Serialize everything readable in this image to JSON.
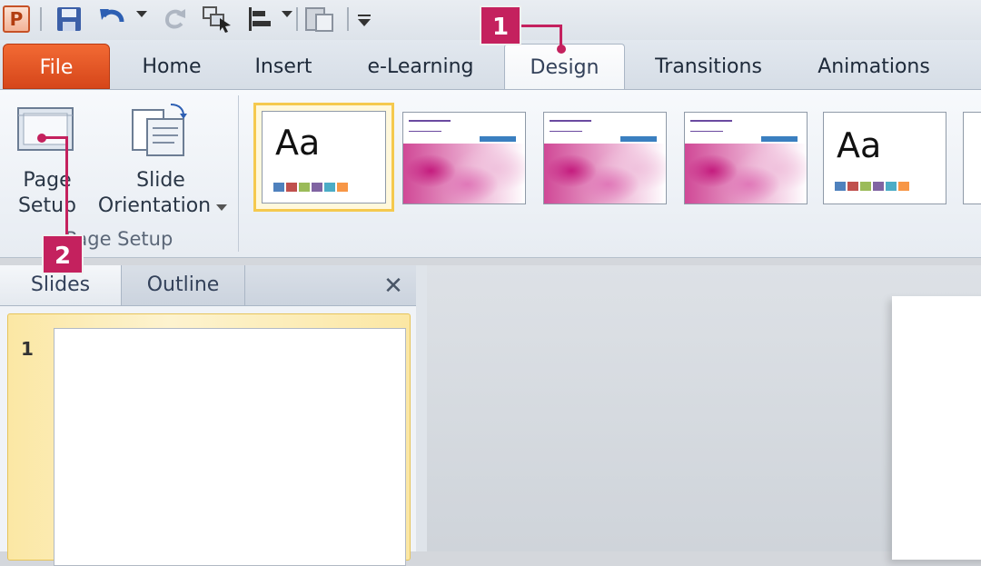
{
  "tabs": [
    "File",
    "Home",
    "Insert",
    "e-Learning",
    "Design",
    "Transitions",
    "Animations"
  ],
  "active_tab": "Design",
  "app_icon_letter": "P",
  "ribbon": {
    "page_setup_line1": "Page",
    "page_setup_line2": "Setup",
    "orientation_line1": "Slide",
    "orientation_line2": "Orientation",
    "group_label": "Page Setup",
    "theme_sample_text": "Aa"
  },
  "pane": {
    "tab_slides": "Slides",
    "tab_outline": "Outline",
    "close_glyph": "✕",
    "slide_number": "1"
  },
  "callouts": [
    "1",
    "2"
  ],
  "theme_colors": [
    "#4f81bd",
    "#c0504d",
    "#9bbb59",
    "#8064a2",
    "#4bacc6",
    "#f79646"
  ]
}
